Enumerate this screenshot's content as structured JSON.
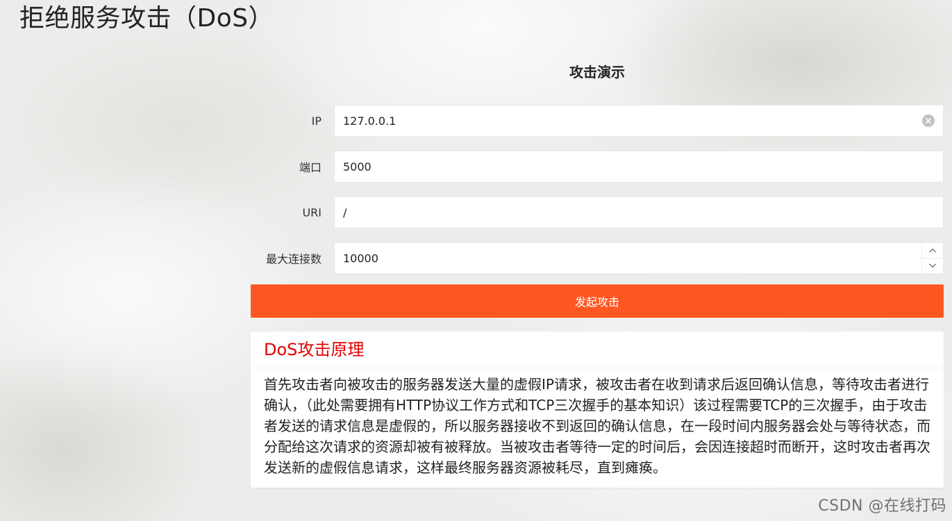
{
  "page": {
    "title": "拒绝服务攻击（DoS）"
  },
  "form": {
    "heading": "攻击演示",
    "fields": [
      {
        "label": "IP",
        "value": "127.0.0.1"
      },
      {
        "label": "端口",
        "value": "5000"
      },
      {
        "label": "URI",
        "value": "/"
      },
      {
        "label": "最大连接数",
        "value": "10000"
      }
    ],
    "submit_label": "发起攻击"
  },
  "card": {
    "title": "DoS攻击原理",
    "body": "首先攻击者向被攻击的服务器发送大量的虚假IP请求，被攻击者在收到请求后返回确认信息，等待攻击者进行确认，（此处需要拥有HTTP协议工作方式和TCP三次握手的基本知识）该过程需要TCP的三次握手，由于攻击者发送的请求信息是虚假的，所以服务器接收不到返回的确认信息，在一段时间内服务器会处与等待状态，而分配给这次请求的资源却被有被释放。当被攻击者等待一定的时间后，会因连接超时而断开，这时攻击者再次发送新的虚假信息请求，这样最终服务器资源被耗尽，直到瘫痪。"
  },
  "watermark": "CSDN @在线打码",
  "icons": {
    "clear": "clear-circle-icon",
    "increment": "chevron-up-icon",
    "decrement": "chevron-down-icon"
  },
  "colors": {
    "accent": "#ff5722",
    "card_title": "#e00000"
  }
}
